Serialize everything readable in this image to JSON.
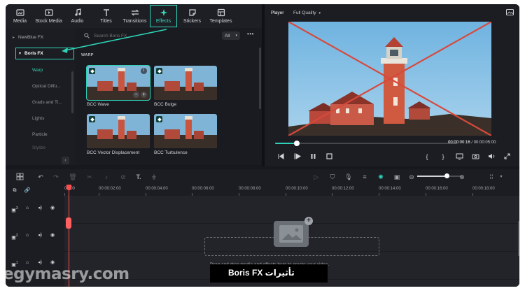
{
  "toolbar": {
    "items": [
      {
        "label": "Media",
        "icon": "media-icon"
      },
      {
        "label": "Stock Media",
        "icon": "stock-media-icon"
      },
      {
        "label": "Audio",
        "icon": "music-note-icon"
      },
      {
        "label": "Titles",
        "icon": "text-t-icon"
      },
      {
        "label": "Transitions",
        "icon": "transition-arrows-icon"
      },
      {
        "label": "Effects",
        "icon": "sparkle-icon",
        "active": true
      },
      {
        "label": "Stickers",
        "icon": "sticker-icon"
      },
      {
        "label": "Templates",
        "icon": "templates-icon"
      }
    ]
  },
  "sidebar": {
    "items": [
      {
        "label": "NewBlue FX",
        "expanded": false
      },
      {
        "label": "Boris FX",
        "expanded": true
      }
    ],
    "sub_items": [
      {
        "label": "Warp",
        "active": true
      },
      {
        "label": "Optical Diffu..."
      },
      {
        "label": "Grads and Ti..."
      },
      {
        "label": "Lights"
      },
      {
        "label": "Particle"
      },
      {
        "label": "Stylize"
      }
    ]
  },
  "effects_panel": {
    "search_placeholder": "Search Boris FX",
    "filter_value": "All",
    "section_title": "WARP",
    "cards": [
      {
        "label": "BCC Wave",
        "selected": true
      },
      {
        "label": "BCC Bulge"
      },
      {
        "label": "BCC Vector Displacement"
      },
      {
        "label": "BCC Turbulence"
      }
    ]
  },
  "player": {
    "tab_label": "Player",
    "quality": "Full Quality",
    "current_time": "00:00:00:16",
    "separator": "/",
    "total_time": "00:00:05:00",
    "progress": 0.12
  },
  "timeline": {
    "ruler_ticks": [
      "00:00",
      "00:00:02:00",
      "00:00:04:00",
      "00:00:06:00",
      "00:00:08:00",
      "00:00:10:00",
      "00:00:12:00",
      "00:00:14:00",
      "00:00:16:00",
      "00:00:18:00"
    ],
    "tracks": [
      "3",
      "2",
      "1"
    ],
    "drop_text": "Drag and drop media and effects here to create your video.",
    "zoom_level": 0.65
  },
  "overlay": {
    "watermark": "egymasry.com",
    "caption": "تأثيرات Boris FX"
  },
  "colors": {
    "accent": "#2ed3b7",
    "playhead": "#ff4d4d",
    "background": "#17181d"
  }
}
